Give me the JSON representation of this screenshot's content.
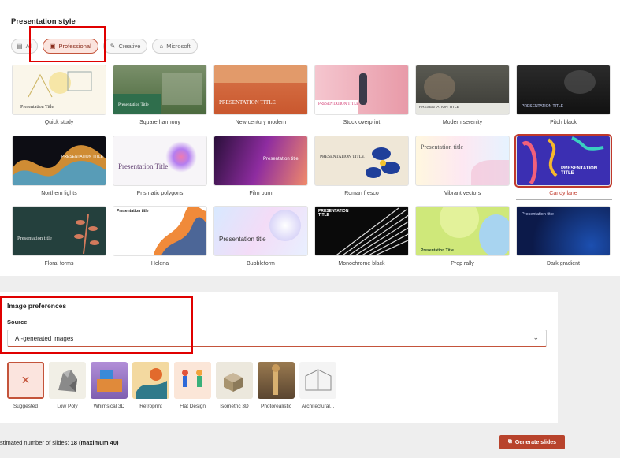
{
  "presentation_style": {
    "title": "Presentation style",
    "filters": [
      {
        "label": "All",
        "icon": "all-icon"
      },
      {
        "label": "Professional",
        "icon": "briefcase-icon",
        "selected": true
      },
      {
        "label": "Creative",
        "icon": "brush-icon"
      },
      {
        "label": "Microsoft",
        "icon": "building-icon"
      }
    ],
    "themes": [
      {
        "name": "Quick study",
        "thumb_text": "Presentation Title"
      },
      {
        "name": "Square harmony",
        "thumb_text": "Presentation Title"
      },
      {
        "name": "New century modern",
        "thumb_text": "PRESENTATION TITLE"
      },
      {
        "name": "Stock overprint",
        "thumb_text": "PRESENTATION TITLE"
      },
      {
        "name": "Modern serenity",
        "thumb_text": "PRESENTATION TITLE"
      },
      {
        "name": "Pitch black",
        "thumb_text": "PRESENTATION TITLE"
      },
      {
        "name": "Northern lights",
        "thumb_text": "PRESENTATION TITLE"
      },
      {
        "name": "Prismatic polygons",
        "thumb_text": "Presentation Title"
      },
      {
        "name": "Film burn",
        "thumb_text": "Presentation title"
      },
      {
        "name": "Roman fresco",
        "thumb_text": "PRESENTATION TITLE"
      },
      {
        "name": "Vibrant vectors",
        "thumb_text": "Presentation title"
      },
      {
        "name": "Candy lane",
        "thumb_text": "PRESENTATION TITLE",
        "selected": true
      },
      {
        "name": "Floral forms",
        "thumb_text": "Presentation title"
      },
      {
        "name": "Helena",
        "thumb_text": "Presentation title"
      },
      {
        "name": "Bubbleform",
        "thumb_text": "Presentation title"
      },
      {
        "name": "Monochrome black",
        "thumb_text": "PRESENTATION TITLE"
      },
      {
        "name": "Prep rally",
        "thumb_text": "Presentation Title"
      },
      {
        "name": "Dark gradient",
        "thumb_text": "Presentation title"
      }
    ]
  },
  "image_preferences": {
    "title": "Image preferences",
    "source_label": "Source",
    "source_value": "AI-generated images",
    "styles": [
      {
        "label": "Suggested",
        "icon": "sparkle-slash-icon",
        "selected": true
      },
      {
        "label": "Low Poly"
      },
      {
        "label": "Whimsical 3D"
      },
      {
        "label": "Retroprint"
      },
      {
        "label": "Flat Design"
      },
      {
        "label": "Isometric 3D"
      },
      {
        "label": "Photorealistic"
      },
      {
        "label": "Architectural..."
      }
    ]
  },
  "footer": {
    "estimate_prefix": "stimated number of slides: ",
    "estimate_value": "18 (maximum 40)",
    "generate_label": "Generate slides"
  },
  "colors": {
    "accent": "#b8432c",
    "highlight_box": "#e00000"
  }
}
